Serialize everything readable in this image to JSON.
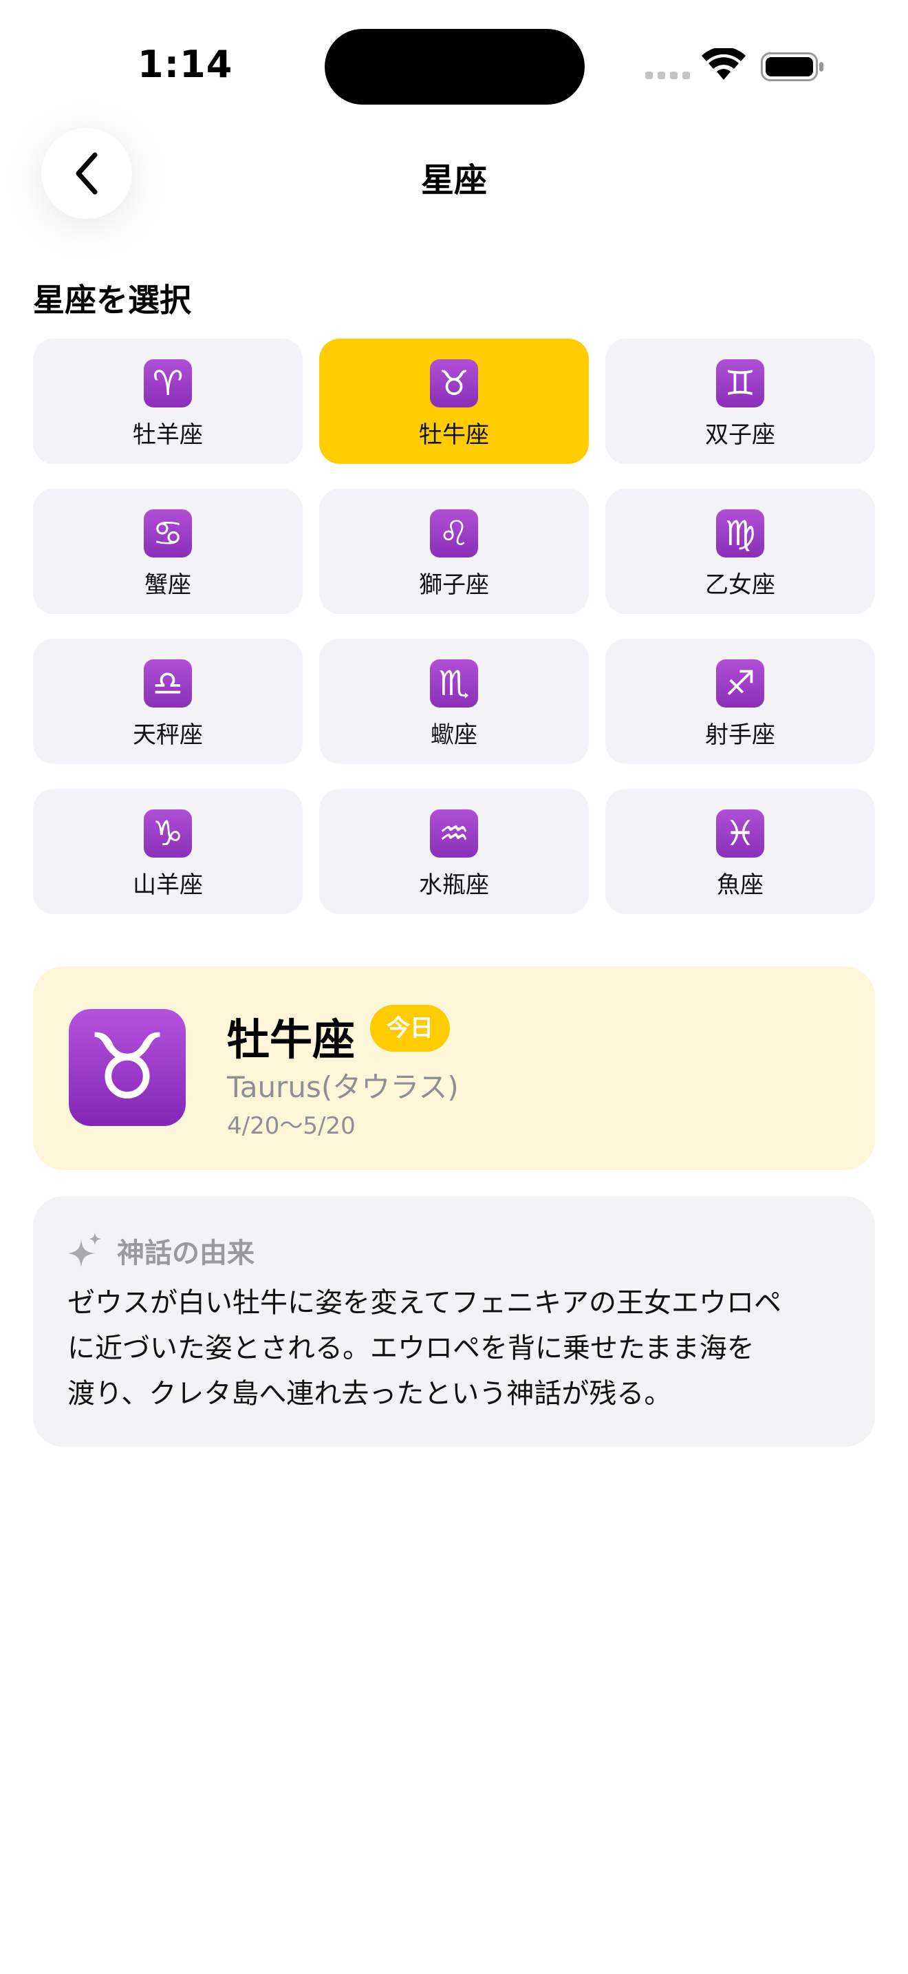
{
  "status": {
    "time": "1:14"
  },
  "header": {
    "title": "星座"
  },
  "section": {
    "title": "星座を選択"
  },
  "signs": [
    {
      "symbol": "♈",
      "label": "牡羊座",
      "selected": false
    },
    {
      "symbol": "♉",
      "label": "牡牛座",
      "selected": true
    },
    {
      "symbol": "♊",
      "label": "双子座",
      "selected": false
    },
    {
      "symbol": "♋",
      "label": "蟹座",
      "selected": false
    },
    {
      "symbol": "♌",
      "label": "獅子座",
      "selected": false
    },
    {
      "symbol": "♍",
      "label": "乙女座",
      "selected": false
    },
    {
      "symbol": "♎",
      "label": "天秤座",
      "selected": false
    },
    {
      "symbol": "♏",
      "label": "蠍座",
      "selected": false
    },
    {
      "symbol": "♐",
      "label": "射手座",
      "selected": false
    },
    {
      "symbol": "♑",
      "label": "山羊座",
      "selected": false
    },
    {
      "symbol": "♒",
      "label": "水瓶座",
      "selected": false
    },
    {
      "symbol": "♓",
      "label": "魚座",
      "selected": false
    }
  ],
  "detail": {
    "symbol": "♉",
    "name": "牡牛座",
    "badge": "今日",
    "english": "Taurus(タウラス)",
    "dates": "4/20〜5/20"
  },
  "myth": {
    "title": "神話の由来",
    "text_lines": [
      "ゼウスが白い牡牛に姿を変えてフェニキアの王女エウロペ",
      "に近づいた姿とされる。エウロペを背に乗せたまま海を",
      "渡り、クレタ島へ連れ去ったという神話が残る。"
    ]
  },
  "colors": {
    "accent": "#ffcc00",
    "card_bg": "#f2f2f7",
    "detail_bg": "#fdf6d8",
    "icon_purple": "#9b3fc8"
  },
  "icons": {
    "back": "chevron-left-icon",
    "wifi": "wifi-icon",
    "battery": "battery-icon",
    "sparkle": "sparkle-icon"
  }
}
